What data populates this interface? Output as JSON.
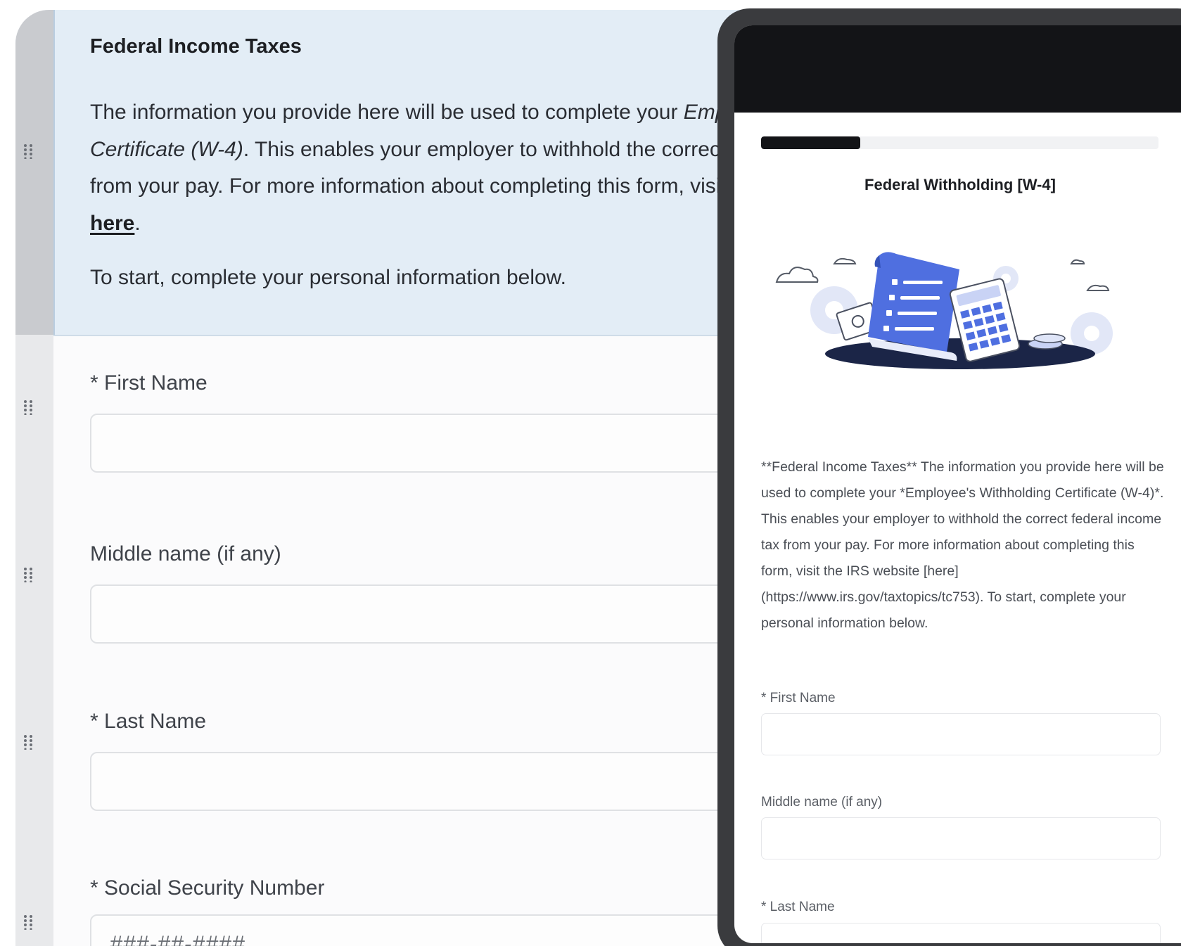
{
  "builder": {
    "intro": {
      "title": "Federal Income Taxes",
      "body_part1": "The information you provide here will be used to complete your ",
      "body_italic": "Employee's Withholding Certificate (W-4)",
      "body_part2": ". This enables your employer to withhold the correct federal income tax from your pay. For more information about completing this form, visit the IRS website ",
      "link_text": "here",
      "body_end": ".",
      "start_text": "To start, complete your personal information below."
    },
    "fields": [
      {
        "label": "* First Name",
        "value": "",
        "placeholder": ""
      },
      {
        "label": "Middle name (if any)",
        "value": "",
        "placeholder": ""
      },
      {
        "label": "* Last Name",
        "value": "",
        "placeholder": ""
      },
      {
        "label": "* Social Security Number",
        "value": "",
        "placeholder": "###-##-####"
      }
    ]
  },
  "preview": {
    "progress": 0.25,
    "title": "Federal Withholding [W-4]",
    "body": "**Federal Income Taxes** The information you provide here will be used to complete your *Employee's Withholding Certificate (W-4)*. This enables your employer to withhold the correct federal income tax from your pay. For more information about completing this form, visit the IRS website [here](https://www.irs.gov/taxtopics/tc753). To start, complete your personal information below.",
    "fields": [
      {
        "label": "* First Name"
      },
      {
        "label": "Middle name (if any)"
      },
      {
        "label": "* Last Name"
      }
    ]
  },
  "colors": {
    "intro_background": "#e3edf6",
    "phone_frame": "#3a3b3e",
    "phone_topbar": "#131417",
    "illustration_blue": "#4f6fe0",
    "illustration_dark": "#1b2547"
  },
  "icons": {
    "drag_handle": "drag-handle-icon"
  }
}
